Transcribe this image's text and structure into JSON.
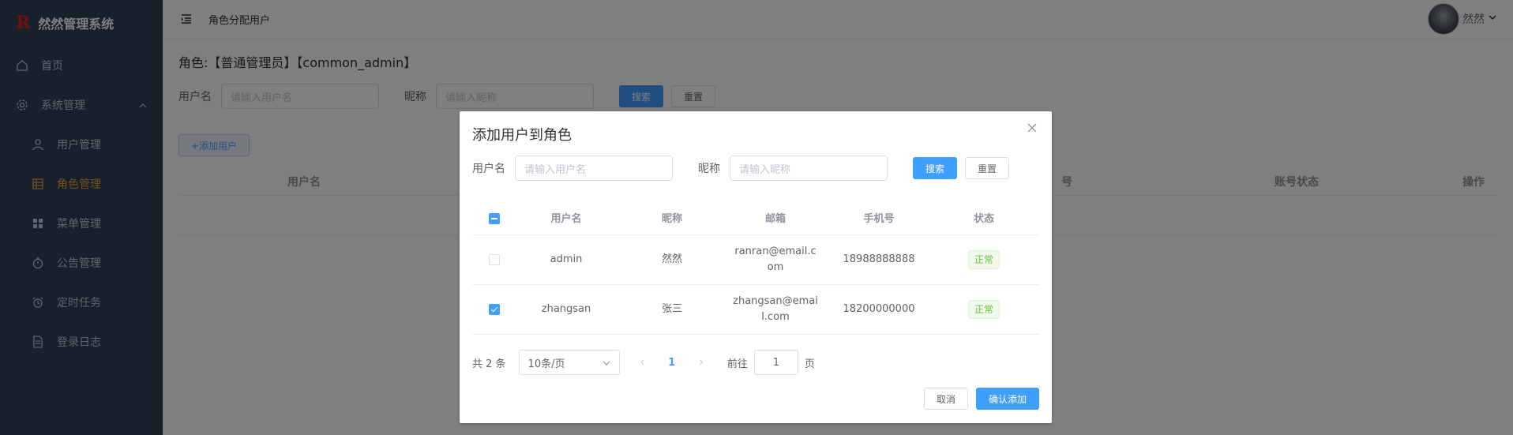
{
  "app": {
    "logo_mark": "R",
    "title": "然然管理系统"
  },
  "sidebar": {
    "items": [
      {
        "label": "首页",
        "icon": "home-icon"
      },
      {
        "label": "系统管理",
        "icon": "gear-icon"
      },
      {
        "label": "用户管理",
        "icon": "user-icon"
      },
      {
        "label": "角色管理",
        "icon": "table-icon",
        "active": true
      },
      {
        "label": "菜单管理",
        "icon": "grid-icon"
      },
      {
        "label": "公告管理",
        "icon": "stopwatch-icon"
      },
      {
        "label": "定时任务",
        "icon": "alarm-icon"
      },
      {
        "label": "登录日志",
        "icon": "document-icon"
      }
    ]
  },
  "header": {
    "title": "角色分配用户",
    "user_name": "然然"
  },
  "page": {
    "role_title": "角色:【普通管理员】【common_admin】",
    "username_label": "用户名",
    "username_placeholder": "请输入用户名",
    "nickname_label": "昵称",
    "nickname_placeholder": "请输入昵称",
    "search_label": "搜索",
    "reset_label": "重置",
    "add_user_label": "+添加用户",
    "table_headers": {
      "username": "用户名",
      "phone_partial": "号",
      "status": "账号状态",
      "actions": "操作"
    }
  },
  "dialog": {
    "title": "添加用户到角色",
    "username_label": "用户名",
    "username_placeholder": "请输入用户名",
    "nickname_label": "昵称",
    "nickname_placeholder": "请输入昵称",
    "search_label": "搜索",
    "reset_label": "重置",
    "columns": [
      "用户名",
      "昵称",
      "邮箱",
      "手机号",
      "状态"
    ],
    "rows": [
      {
        "username": "admin",
        "nickname": "然然",
        "email": "ranran@email.com",
        "phone": "18988888888",
        "status": "正常",
        "checked": false
      },
      {
        "username": "zhangsan",
        "nickname": "张三",
        "email": "zhangsan@email.com",
        "phone": "18200000000",
        "status": "正常",
        "checked": true
      }
    ],
    "pagination": {
      "total_text": "共 2 条",
      "page_size": "10条/页",
      "current_page": "1",
      "goto_label": "前往",
      "goto_value": "1",
      "page_suffix": "页"
    },
    "cancel_label": "取消",
    "confirm_label": "确认添加"
  },
  "colors": {
    "sidebar_bg": "#304156",
    "primary": "#409eff",
    "active_menu": "#e6a23c",
    "success": "#67c23a"
  }
}
